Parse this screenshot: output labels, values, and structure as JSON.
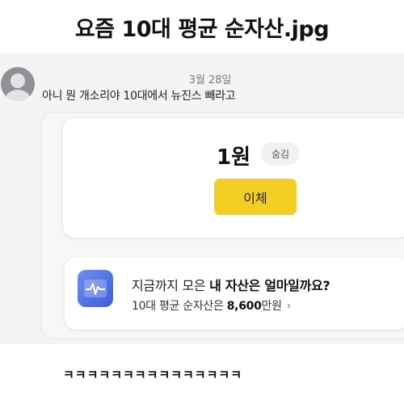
{
  "headline": "요즘 10대 평균 순자산.jpg",
  "chat": {
    "date": "3월 28일",
    "message": "아니 뭔 개소리야 10대에서 뉴진스 빼라고"
  },
  "balance": {
    "amount": "1원",
    "hide_label": "숨김",
    "transfer_label": "이체"
  },
  "asset_card": {
    "icon": "asset-chart-icon",
    "question_prefix": "지금까지 모은 ",
    "question_bold": "내 자산은 얼마일까요?",
    "avg_prefix": "10대 평균 순자산은 ",
    "avg_value": "8,600",
    "avg_unit": "만원",
    "chevron": "›"
  },
  "caption": "ㅋㅋㅋㅋㅋㅋㅋㅋㅋㅋㅋㅋㅋㅋㅋ",
  "colors": {
    "accent_yellow": "#f3ce25",
    "icon_blue": "#4a6fe3"
  }
}
